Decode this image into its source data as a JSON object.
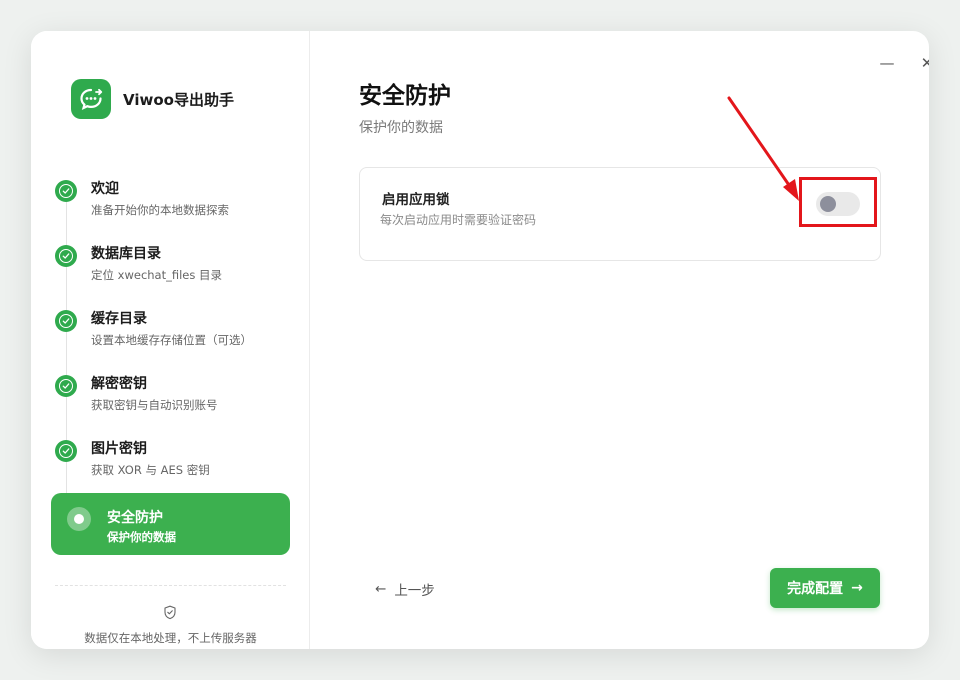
{
  "app": {
    "name": "Viwoo导出助手"
  },
  "steps": [
    {
      "title": "欢迎",
      "desc": "准备开始你的本地数据探索",
      "status": "done"
    },
    {
      "title": "数据库目录",
      "desc": "定位 xwechat_files 目录",
      "status": "done"
    },
    {
      "title": "缓存目录",
      "desc": "设置本地缓存存储位置（可选）",
      "status": "done"
    },
    {
      "title": "解密密钥",
      "desc": "获取密钥与自动识别账号",
      "status": "done"
    },
    {
      "title": "图片密钥",
      "desc": "获取 XOR 与 AES 密钥",
      "status": "done"
    },
    {
      "title": "安全防护",
      "desc": "保护你的数据",
      "status": "active"
    }
  ],
  "sidebar_footer": {
    "privacy_text": "数据仅在本地处理，不上传服务器",
    "icon": "shield-check-icon"
  },
  "window_controls": {
    "minimize": "—",
    "close": "✕"
  },
  "page": {
    "title": "安全防护",
    "subtitle": "保护你的数据"
  },
  "app_lock": {
    "title": "启用应用锁",
    "desc": "每次启动应用时需要验证密码",
    "enabled": false
  },
  "nav": {
    "back_label": "上一步",
    "back_icon": "←",
    "finish_label": "完成配置",
    "finish_icon": "→"
  },
  "colors": {
    "accent": "#3cb04f",
    "annotation": "#e3161b"
  }
}
